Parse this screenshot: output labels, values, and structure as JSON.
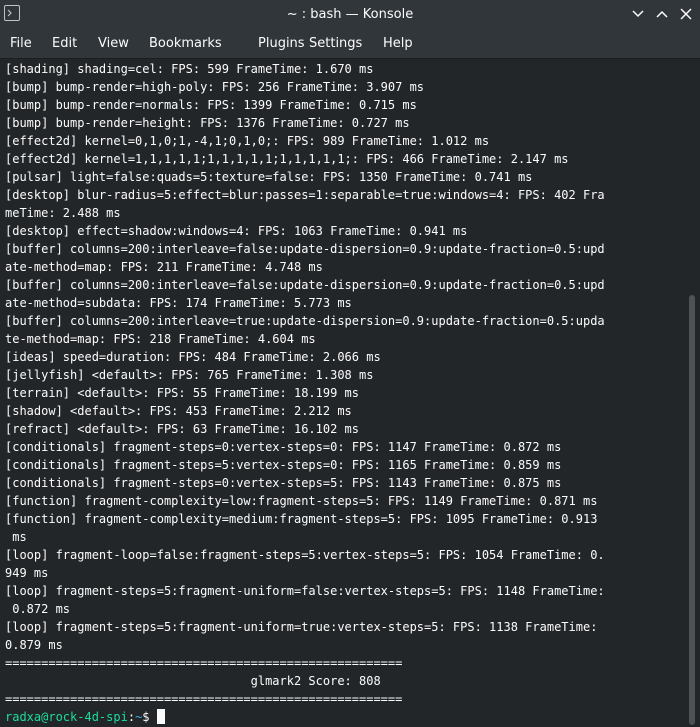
{
  "window": {
    "title": "~ : bash — Konsole",
    "icons": {
      "app": "terminal-icon",
      "minimize": "chevron-down-icon",
      "maximize": "chevron-up-icon",
      "close": "close-icon"
    }
  },
  "menubar": {
    "file": "File",
    "edit": "Edit",
    "view": "View",
    "bookmarks": "Bookmarks",
    "plugins": "Plugins",
    "settings": "Settings",
    "help": "Help"
  },
  "terminal": {
    "lines": [
      "[shading] shading=cel: FPS: 599 FrameTime: 1.670 ms",
      "[bump] bump-render=high-poly: FPS: 256 FrameTime: 3.907 ms",
      "[bump] bump-render=normals: FPS: 1399 FrameTime: 0.715 ms",
      "[bump] bump-render=height: FPS: 1376 FrameTime: 0.727 ms",
      "[effect2d] kernel=0,1,0;1,-4,1;0,1,0;: FPS: 989 FrameTime: 1.012 ms",
      "[effect2d] kernel=1,1,1,1,1;1,1,1,1,1;1,1,1,1,1;: FPS: 466 FrameTime: 2.147 ms",
      "[pulsar] light=false:quads=5:texture=false: FPS: 1350 FrameTime: 0.741 ms",
      "[desktop] blur-radius=5:effect=blur:passes=1:separable=true:windows=4: FPS: 402 Fra",
      "meTime: 2.488 ms",
      "[desktop] effect=shadow:windows=4: FPS: 1063 FrameTime: 0.941 ms",
      "[buffer] columns=200:interleave=false:update-dispersion=0.9:update-fraction=0.5:upd",
      "ate-method=map: FPS: 211 FrameTime: 4.748 ms",
      "[buffer] columns=200:interleave=false:update-dispersion=0.9:update-fraction=0.5:upd",
      "ate-method=subdata: FPS: 174 FrameTime: 5.773 ms",
      "[buffer] columns=200:interleave=true:update-dispersion=0.9:update-fraction=0.5:upda",
      "te-method=map: FPS: 218 FrameTime: 4.604 ms",
      "[ideas] speed=duration: FPS: 484 FrameTime: 2.066 ms",
      "[jellyfish] <default>: FPS: 765 FrameTime: 1.308 ms",
      "[terrain] <default>: FPS: 55 FrameTime: 18.199 ms",
      "[shadow] <default>: FPS: 453 FrameTime: 2.212 ms",
      "[refract] <default>: FPS: 63 FrameTime: 16.102 ms",
      "[conditionals] fragment-steps=0:vertex-steps=0: FPS: 1147 FrameTime: 0.872 ms",
      "[conditionals] fragment-steps=5:vertex-steps=0: FPS: 1165 FrameTime: 0.859 ms",
      "[conditionals] fragment-steps=0:vertex-steps=5: FPS: 1143 FrameTime: 0.875 ms",
      "[function] fragment-complexity=low:fragment-steps=5: FPS: 1149 FrameTime: 0.871 ms",
      "[function] fragment-complexity=medium:fragment-steps=5: FPS: 1095 FrameTime: 0.913",
      " ms",
      "[loop] fragment-loop=false:fragment-steps=5:vertex-steps=5: FPS: 1054 FrameTime: 0.",
      "949 ms",
      "[loop] fragment-steps=5:fragment-uniform=false:vertex-steps=5: FPS: 1148 FrameTime:",
      " 0.872 ms",
      "[loop] fragment-steps=5:fragment-uniform=true:vertex-steps=5: FPS: 1138 FrameTime:",
      "0.879 ms",
      "=======================================================",
      "                                  glmark2 Score: 808",
      "======================================================="
    ],
    "prompt": {
      "user_host": "radxa@rock-4d-spi",
      "separator": ":",
      "path": "~",
      "symbol": "$ "
    }
  },
  "colors": {
    "background": "#232629",
    "chrome": "#31363b",
    "text": "#fcfcfc",
    "prompt_user": "#1cdc9a",
    "prompt_path": "#3daee9"
  }
}
